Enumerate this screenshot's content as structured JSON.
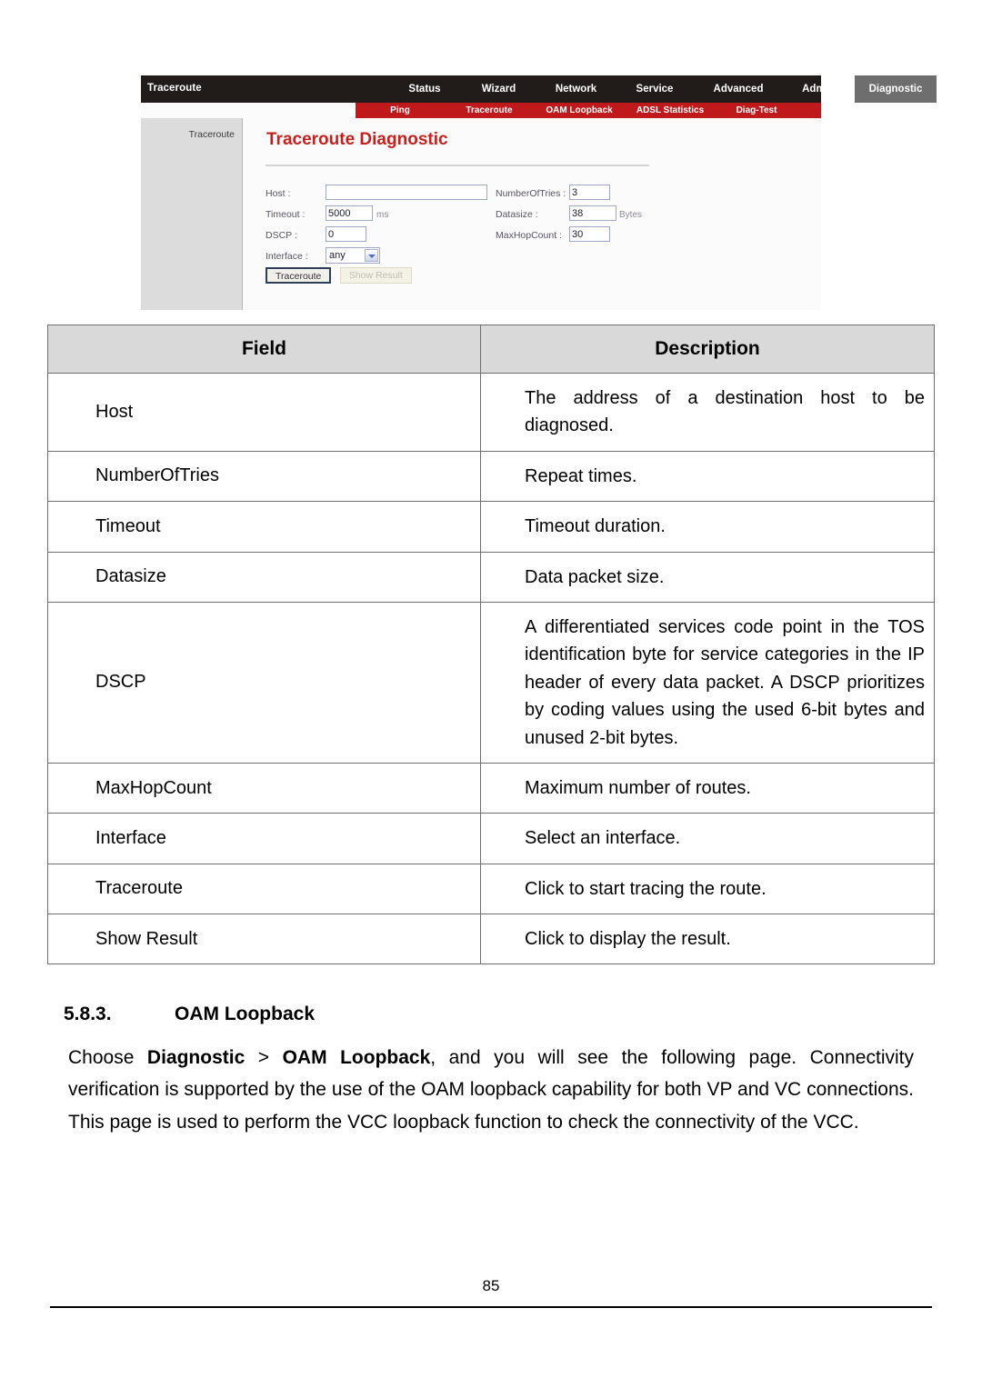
{
  "screenshot": {
    "brand": "Traceroute",
    "top_nav": [
      {
        "label": "Status",
        "active": false
      },
      {
        "label": "Wizard",
        "active": false
      },
      {
        "label": "Network",
        "active": false
      },
      {
        "label": "Service",
        "active": false
      },
      {
        "label": "Advanced",
        "active": false
      },
      {
        "label": "Admin",
        "active": false
      },
      {
        "label": "Diagnostic",
        "active": true
      }
    ],
    "sub_nav": [
      "Ping",
      "Traceroute",
      "OAM Loopback",
      "ADSL Statistics",
      "Diag-Test"
    ],
    "sidebar_item": "Traceroute",
    "page_title": "Traceroute Diagnostic",
    "form": {
      "host_label": "Host :",
      "host_value": "",
      "numberoftries_label": "NumberOfTries :",
      "numberoftries_value": "3",
      "timeout_label": "Timeout :",
      "timeout_value": "5000",
      "timeout_unit": "ms",
      "datasize_label": "Datasize :",
      "datasize_value": "38",
      "datasize_unit": "Bytes",
      "dscp_label": "DSCP :",
      "dscp_value": "0",
      "maxhopcount_label": "MaxHopCount :",
      "maxhopcount_value": "30",
      "interface_label": "Interface :",
      "interface_value": "any"
    },
    "buttons": {
      "traceroute": "Traceroute",
      "show_result": "Show Result"
    },
    "colors": {
      "nav_black": "#211c1a",
      "nav_active": "#6e6e6e",
      "sub_nav_red": "#c0191c",
      "title_red": "#c6201f",
      "sidebar_gray": "#dcdcdc"
    }
  },
  "table": {
    "headers": [
      "Field",
      "Description"
    ],
    "rows": [
      {
        "field": "Host",
        "desc": "The address of a destination host to be diagnosed."
      },
      {
        "field": "NumberOfTries",
        "desc": "Repeat times."
      },
      {
        "field": "Timeout",
        "desc": "Timeout duration."
      },
      {
        "field": "Datasize",
        "desc": "Data packet size."
      },
      {
        "field": "DSCP",
        "desc": "A differentiated services code point in the TOS identification byte for service categories in the IP header of every data packet. A DSCP prioritizes by coding values using the used 6-bit bytes and unused 2-bit bytes."
      },
      {
        "field": "MaxHopCount",
        "desc": "Maximum number of routes."
      },
      {
        "field": "Interface",
        "desc": "Select an interface."
      },
      {
        "field": "Traceroute",
        "desc": "Click to start tracing the route."
      },
      {
        "field": "Show Result",
        "desc": "Click to display the result."
      }
    ]
  },
  "section": {
    "number": "5.8.3.",
    "title": "OAM Loopback",
    "paragraph_part1": "Choose ",
    "paragraph_bold1": "Diagnostic",
    "paragraph_part2": " > ",
    "paragraph_bold2": "OAM Loopback",
    "paragraph_part3": ", and you will see the following page. Connectivity verification is supported by the use of the OAM loopback capability for both VP and VC connections. This page is used to perform the VCC loopback function to check the connectivity of the VCC."
  },
  "footer": {
    "page_number": "85"
  }
}
